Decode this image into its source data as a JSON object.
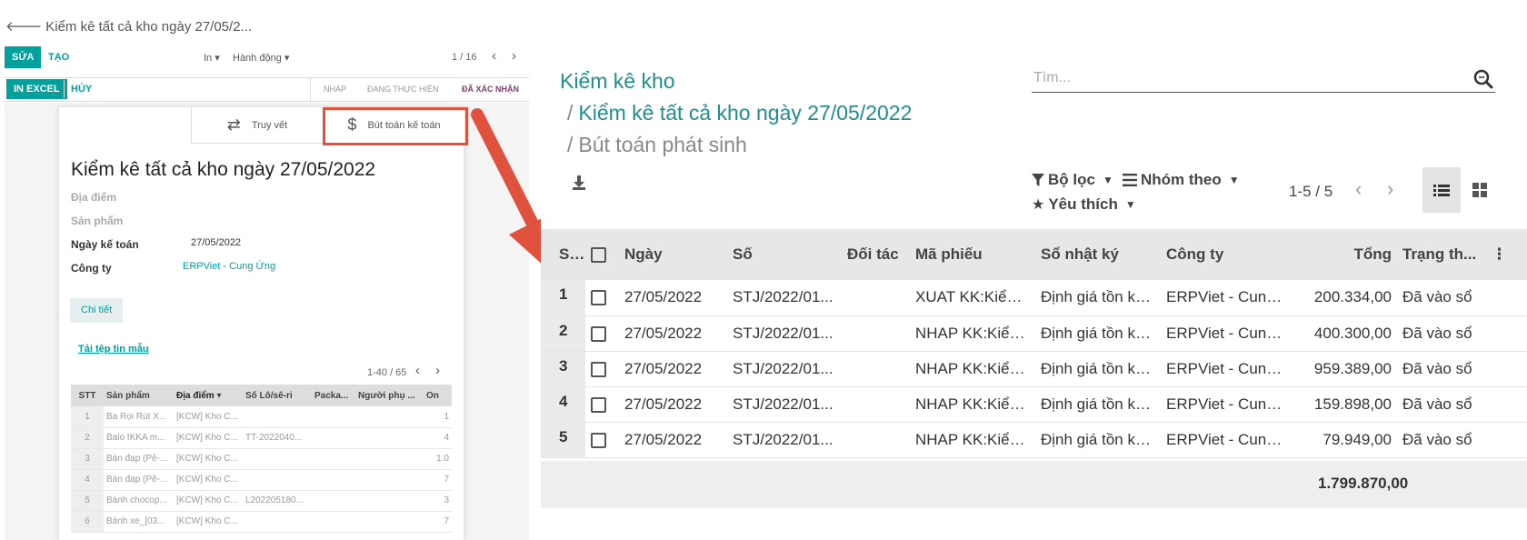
{
  "left": {
    "breadcrumb": "Kiểm kê tất cả kho ngày 27/05/2...",
    "edit_label": "SỬA",
    "create_label": "TẠO",
    "print_label": "In",
    "action_label": "Hành động",
    "pager": "1 / 16",
    "excel_label": "IN EXCEL",
    "cancel_label": "HỦY",
    "status": [
      "NHÁP",
      "ĐANG THỰC HIỆN",
      "ĐÃ XÁC NHẬN"
    ],
    "smart_buttons": [
      "Truy vết",
      "Bút toán kế toán"
    ],
    "title": "Kiểm kê tất cả kho ngày 27/05/2022",
    "fields": {
      "location": "Địa điểm",
      "product": "Sản phẩm",
      "acc_date_label": "Ngày kế toán",
      "acc_date_value": "27/05/2022",
      "company_label": "Công ty",
      "company_value": "ERPViet - Cung Ứng"
    },
    "detail_tab": "Chi tiết",
    "template_link": "Tải tệp tin mẫu",
    "lines_pager": "1-40 / 65",
    "table": {
      "headers": [
        "STT",
        "Sản phẩm",
        "Địa điểm",
        "Số Lô/sê-ri",
        "Packa...",
        "Người phụ ...",
        "On"
      ],
      "rows": [
        [
          "1",
          "Ba Rọi Rút X...",
          "[KCW] Kho C...",
          "",
          "",
          "",
          "1"
        ],
        [
          "2",
          "Balo IKKA m...",
          "[KCW] Kho C...",
          "TT-2022040...",
          "",
          "",
          "4"
        ],
        [
          "3",
          "Bàn đạp (Pê-...",
          "[KCW] Kho C...",
          "",
          "",
          "",
          "1.0"
        ],
        [
          "4",
          "Bàn đạp (Pê-...",
          "[KCW] Kho C...",
          "",
          "",
          "",
          "7"
        ],
        [
          "5",
          "Bánh chocop...",
          "[KCW] Kho C...",
          "L202205180...",
          "",
          "",
          "3"
        ],
        [
          "6",
          "Bánh xe_[03...",
          "[KCW] Kho C...",
          "",
          "",
          "",
          "7"
        ]
      ]
    }
  },
  "right": {
    "crumb1": "Kiểm kê kho",
    "crumb2": "Kiểm kê tất cả kho ngày 27/05/2022",
    "crumb3": "Bút toán phát sinh",
    "slash": "/",
    "search_placeholder": "Tìm...",
    "filter_label": "Bộ lọc",
    "group_label": "Nhóm theo",
    "fav_label": "Yêu thích",
    "pager": "1-5 / 5",
    "headers": [
      "S...",
      "",
      "Ngày",
      "Số",
      "Đối tác",
      "Mã phiếu",
      "Sổ nhật ký",
      "Công ty",
      "Tổng",
      "Trạng th..."
    ],
    "rows": [
      {
        "no": "1",
        "date": "27/05/2022",
        "num": "STJ/2022/01...",
        "partner": "",
        "ref": "XUAT KK:Kiểm ...",
        "journal": "Định giá tồn kh...",
        "company": "ERPViet - Cung ...",
        "total": "200.334,00",
        "state": "Đã vào sổ"
      },
      {
        "no": "2",
        "date": "27/05/2022",
        "num": "STJ/2022/01...",
        "partner": "",
        "ref": "NHAP KK:Kiểm...",
        "journal": "Định giá tồn kh...",
        "company": "ERPViet - Cung ...",
        "total": "400.300,00",
        "state": "Đã vào sổ"
      },
      {
        "no": "3",
        "date": "27/05/2022",
        "num": "STJ/2022/01...",
        "partner": "",
        "ref": "NHAP KK:Kiểm...",
        "journal": "Định giá tồn kh...",
        "company": "ERPViet - Cung ...",
        "total": "959.389,00",
        "state": "Đã vào sổ"
      },
      {
        "no": "4",
        "date": "27/05/2022",
        "num": "STJ/2022/01...",
        "partner": "",
        "ref": "NHAP KK:Kiểm...",
        "journal": "Định giá tồn kh...",
        "company": "ERPViet - Cung ...",
        "total": "159.898,00",
        "state": "Đã vào sổ"
      },
      {
        "no": "5",
        "date": "27/05/2022",
        "num": "STJ/2022/01...",
        "partner": "",
        "ref": "NHAP KK:Kiểm...",
        "journal": "Định giá tồn kh...",
        "company": "ERPViet - Cung ...",
        "total": "79.949,00",
        "state": "Đã vào sổ"
      }
    ],
    "grand_total": "1.799.870,00"
  },
  "colors": {
    "primary": "#00A09D",
    "title": "#1F8F8A",
    "highlight": "#E0523E",
    "active_status": "#7C3D6E"
  }
}
